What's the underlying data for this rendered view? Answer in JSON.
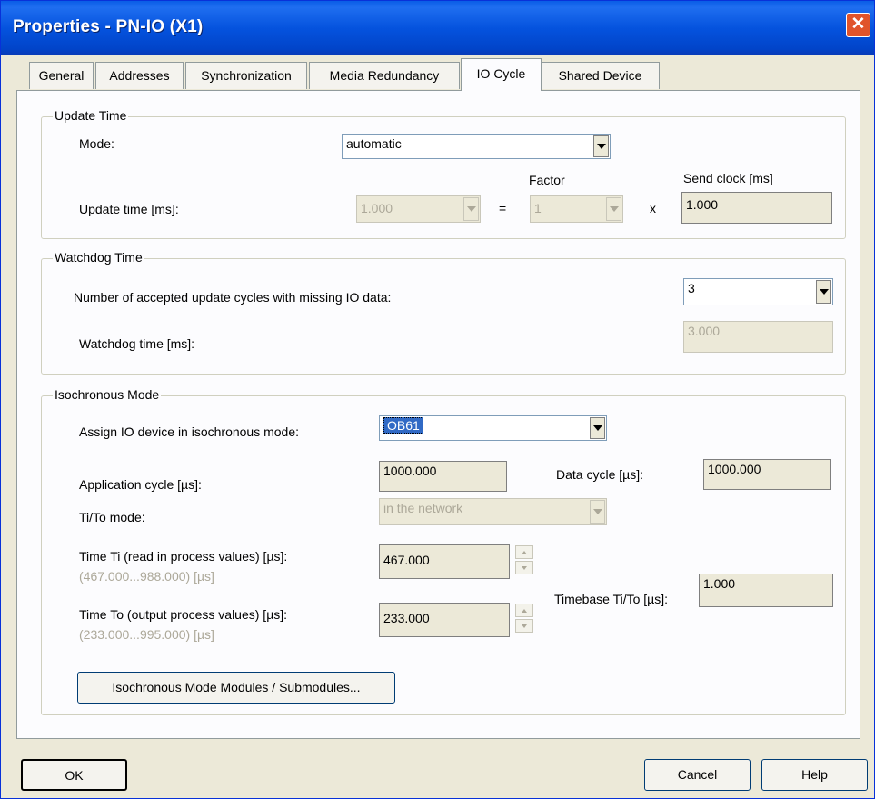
{
  "window": {
    "title": "Properties - PN-IO (X1)"
  },
  "tabs": [
    {
      "label": "General",
      "active": false
    },
    {
      "label": "Addresses",
      "active": false
    },
    {
      "label": "Synchronization",
      "active": false
    },
    {
      "label": "Media Redundancy",
      "active": false
    },
    {
      "label": "IO Cycle",
      "active": true
    },
    {
      "label": "Shared Device",
      "active": false
    }
  ],
  "update_time": {
    "group_title": "Update Time",
    "mode_label": "Mode:",
    "mode_value": "automatic",
    "update_time_label": "Update time [ms]:",
    "update_time_value": "1.000",
    "equals": "=",
    "factor_label": "Factor",
    "factor_value": "1",
    "times": "x",
    "send_clock_label": "Send clock [ms]",
    "send_clock_value": "1.000"
  },
  "watchdog": {
    "group_title": "Watchdog Time",
    "cycles_label": "Number of accepted update cycles with missing IO data:",
    "cycles_value": "3",
    "time_label": "Watchdog time [ms]:",
    "time_value": "3.000"
  },
  "isochronous": {
    "group_title": "Isochronous Mode",
    "assign_label": "Assign IO device in isochronous mode:",
    "assign_value": "OB61",
    "app_cycle_label": "Application cycle [µs]:",
    "app_cycle_value": "1000.000",
    "data_cycle_label": "Data cycle [µs]:",
    "data_cycle_value": "1000.000",
    "tito_mode_label": "Ti/To mode:",
    "tito_mode_value": "in the network",
    "ti_label": "Time Ti (read in process values) [µs]:",
    "ti_range": "(467.000...988.000) [µs]",
    "ti_value": "467.000",
    "to_label": "Time To (output process values) [µs]:",
    "to_range": "(233.000...995.000) [µs]",
    "to_value": "233.000",
    "timebase_label": "Timebase Ti/To [µs]:",
    "timebase_value": "1.000",
    "modules_button": "Isochronous Mode Modules / Submodules..."
  },
  "footer": {
    "ok": "OK",
    "cancel": "Cancel",
    "help": "Help"
  },
  "colors": {
    "titlebar": "#0553de",
    "dialog_bg": "#ece9d8",
    "panel_bg": "#fcfcfe",
    "selection": "#316ac5",
    "close_button": "#e0542b"
  },
  "icons": {
    "close": "close-x-icon",
    "dropdown": "dropdown-arrow-icon",
    "spin": "spin-arrows-icon"
  }
}
